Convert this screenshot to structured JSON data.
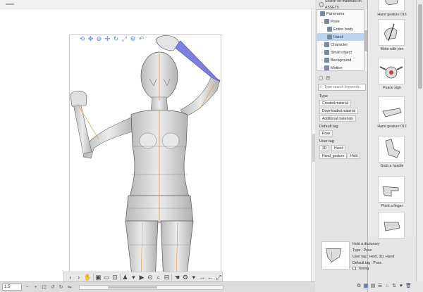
{
  "object_toolbar": {
    "icons": [
      "camera-rotate-icon",
      "camera-pan-icon",
      "camera-zoom-icon",
      "move-icon",
      "rotate-object-icon",
      "scale-object-icon",
      "gear-icon",
      "undo-icon"
    ]
  },
  "zoom": "1.5",
  "library": {
    "search_assets_label": "Search for materials on ASSETS",
    "tree": [
      {
        "label": "Panorama",
        "level": 1,
        "selected": false
      },
      {
        "label": "Pose",
        "level": 1,
        "selected": false
      },
      {
        "label": "Entire body",
        "level": 2,
        "selected": false
      },
      {
        "label": "Hand",
        "level": 2,
        "selected": true
      },
      {
        "label": "Character",
        "level": 1,
        "selected": false
      },
      {
        "label": "Small object",
        "level": 1,
        "selected": false
      },
      {
        "label": "Background",
        "level": 1,
        "selected": false
      },
      {
        "label": "Motion",
        "level": 1,
        "selected": false
      }
    ],
    "search_placeholder": "Type search keywords",
    "type_label": "Type",
    "type_tags": [
      "Created material",
      "Downloaded material",
      "Additional materials"
    ],
    "default_tag_label": "Default tag",
    "default_tags": [
      "Pose"
    ],
    "user_tag_label": "User tag",
    "user_tags": [
      "3D",
      "Hand",
      "Hand_gesture",
      "Hold"
    ]
  },
  "materials": [
    {
      "label": "Hand gesture 016",
      "icon": "hand-gesture-icon"
    },
    {
      "label": "Write with pen",
      "icon": "hand-pen-icon"
    },
    {
      "label": "Peace sign",
      "icon": "hand-peace-icon"
    },
    {
      "label": "Hand gesture 012",
      "icon": "hand-gesture-icon"
    },
    {
      "label": "Grab a handle",
      "icon": "hand-grab-icon"
    },
    {
      "label": "Point a finger",
      "icon": "hand-point-icon"
    },
    {
      "label": "",
      "icon": "hand-gesture-icon"
    }
  ],
  "detail": {
    "name": "Hold a dictionary",
    "type": "Type : Pose",
    "user_tag": "User tag : Hold, 3D, Hand",
    "default_tag": "Default tag : Pose",
    "toning_label": "Toning"
  },
  "colors": {
    "selection_highlight": "#bcd4f2",
    "figure_body": "#d9d9d9",
    "figure_highlight": "#7b7fe0",
    "centerline": "#e38b2c"
  }
}
